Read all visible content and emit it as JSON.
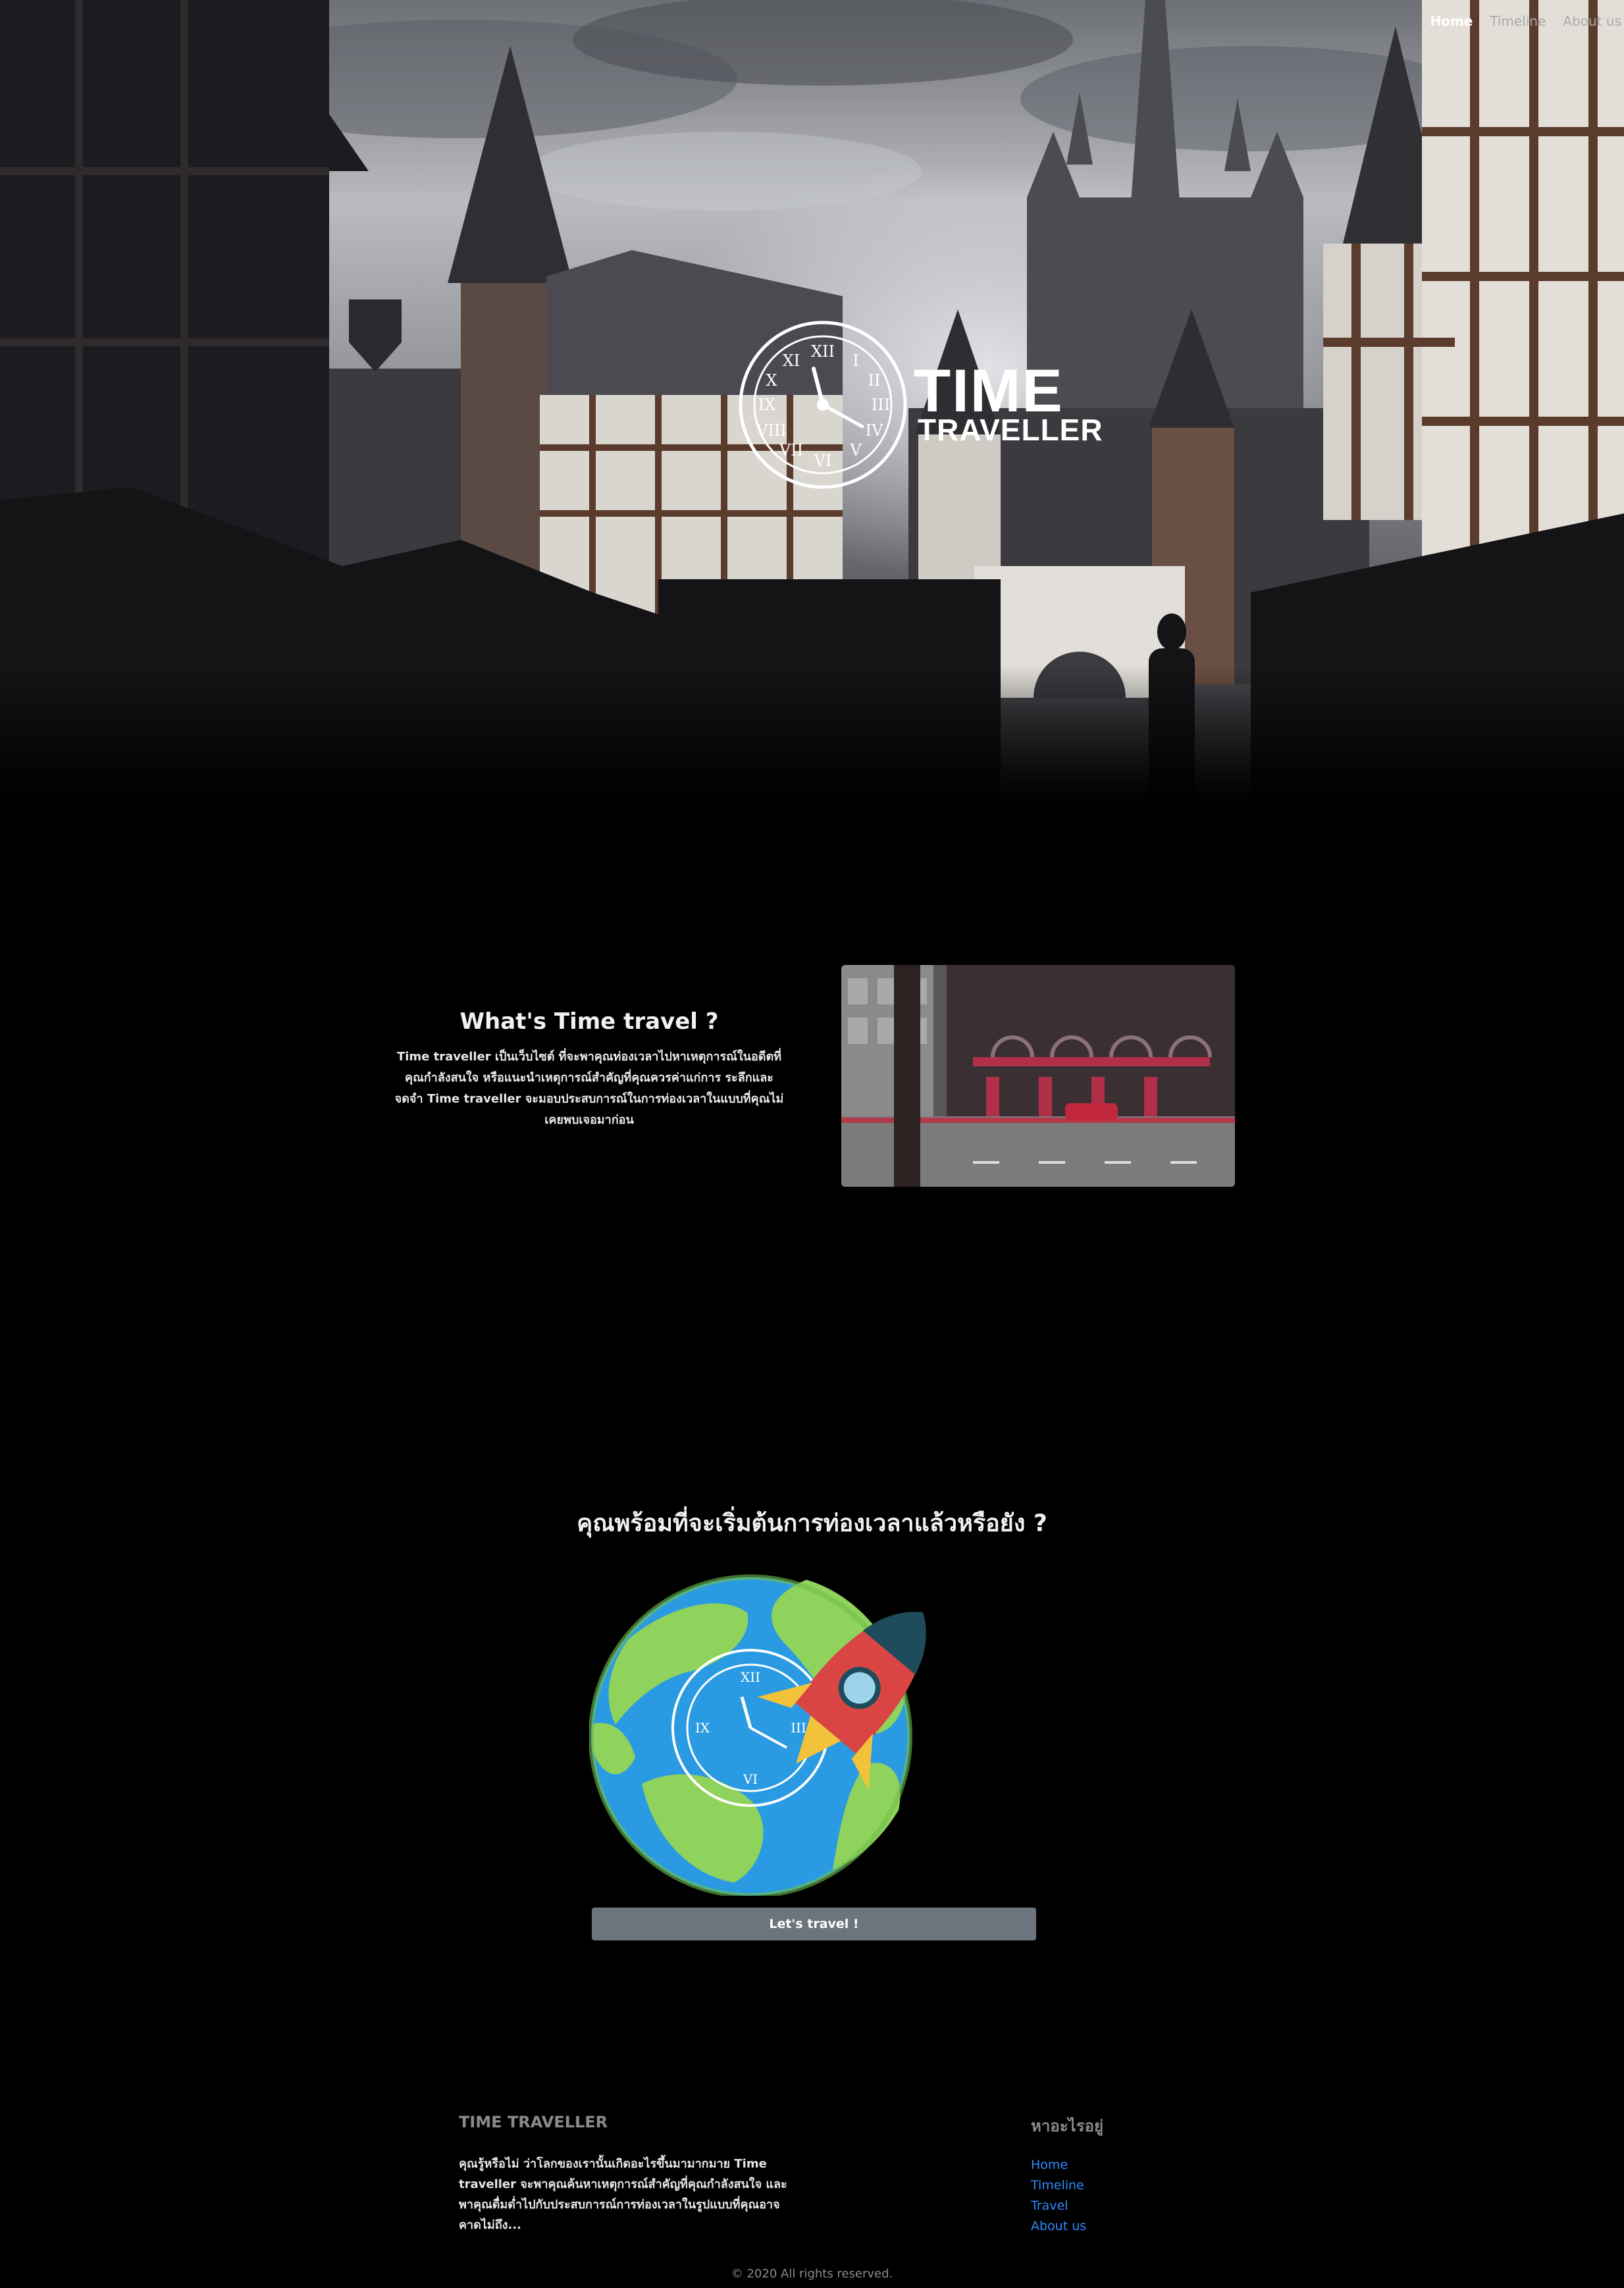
{
  "nav": {
    "items": [
      {
        "label": "Home",
        "active": true
      },
      {
        "label": "Timeline",
        "active": false
      },
      {
        "label": "About us",
        "active": false
      }
    ]
  },
  "hero": {
    "logo_title": "TIME",
    "logo_subtitle": "TRAVELLER",
    "logo_icon": "clock-icon"
  },
  "about": {
    "heading": "What's Time travel ?",
    "text": "Time traveller เป็นเว็บไซต์ ที่จะพาคุณท่องเวลาไปหาเหตุการณ์ในอดีตที่คุณกำลังสนใจ หรือแนะนำเหตุการณ์สำคัญที่คุณควรค่าแก่การ ระลึกและจดจำ Time traveller จะมอบประสบการณ์ในการท่องเวลาในแบบที่คุณไม่เคยพบเจอมาก่อน"
  },
  "cta": {
    "heading": "คุณพร้อมที่จะเริ่มต้นการท่องเวลาแล้วหรือยัง ?",
    "button_label": "Let's travel !",
    "illustration": "globe-clock-rocket"
  },
  "footer": {
    "brand": "TIME TRAVELLER",
    "description": "คุณรู้หรือไม่ ว่าโลกของเรานั้นเกิดอะไรขึ้นมามากมาย Time traveller จะพาคุณค้นหาเหตุการณ์สำคัญที่คุณกำลังสนใจ และพาคุณดื่มด่ำไปกับประสบการณ์การท่องเวลาในรูปแบบที่คุณอาจคาดไม่ถึง...",
    "links_title": "หาอะไรอยู่",
    "links": [
      "Home",
      "Timeline",
      "Travel",
      "About us"
    ],
    "copyright": "© 2020 All rights reserved."
  },
  "colors": {
    "background": "#000000",
    "button": "#6c757d",
    "link": "#2e8bff",
    "muted": "#8a8a8a"
  }
}
